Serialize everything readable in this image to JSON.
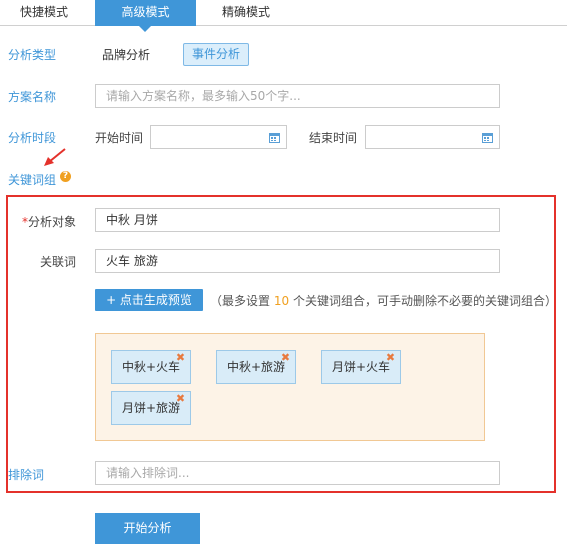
{
  "tabs": [
    {
      "label": "快捷模式"
    },
    {
      "label": "高级模式"
    },
    {
      "label": "精确模式"
    }
  ],
  "analysis_type": {
    "label": "分析类型",
    "options": [
      "品牌分析",
      "事件分析"
    ],
    "selected": "事件分析"
  },
  "plan_name": {
    "label": "方案名称",
    "placeholder": "请输入方案名称，最多输入50个字..."
  },
  "time_range": {
    "label": "分析时段",
    "start_label": "开始时间",
    "end_label": "结束时间"
  },
  "keyword_group": {
    "label": "关键词组",
    "help_icon": "question-circle-icon"
  },
  "analysis_target": {
    "required_mark": "*",
    "label": "分析对象",
    "value": "中秋 月饼"
  },
  "related_words": {
    "label": "关联词",
    "value": "火车 旅游"
  },
  "generate": {
    "button_label": "+ 点击生成预览",
    "hint_prefix": "（最多设置",
    "hint_number": "10",
    "hint_suffix": "个关键词组合，可手动删除不必要的关键词组合）"
  },
  "combinations": [
    {
      "label": "中秋+火车"
    },
    {
      "label": "中秋+旅游"
    },
    {
      "label": "月饼+火车"
    },
    {
      "label": "月饼+旅游"
    }
  ],
  "exclude": {
    "label": "排除词",
    "placeholder": "请输入排除词..."
  },
  "start_button": "开始分析",
  "colors": {
    "accent": "#3f96d8",
    "highlight_box": "#e4312b",
    "preview_bg": "#fdf3e7",
    "chip_remove": "#e87a3f"
  }
}
